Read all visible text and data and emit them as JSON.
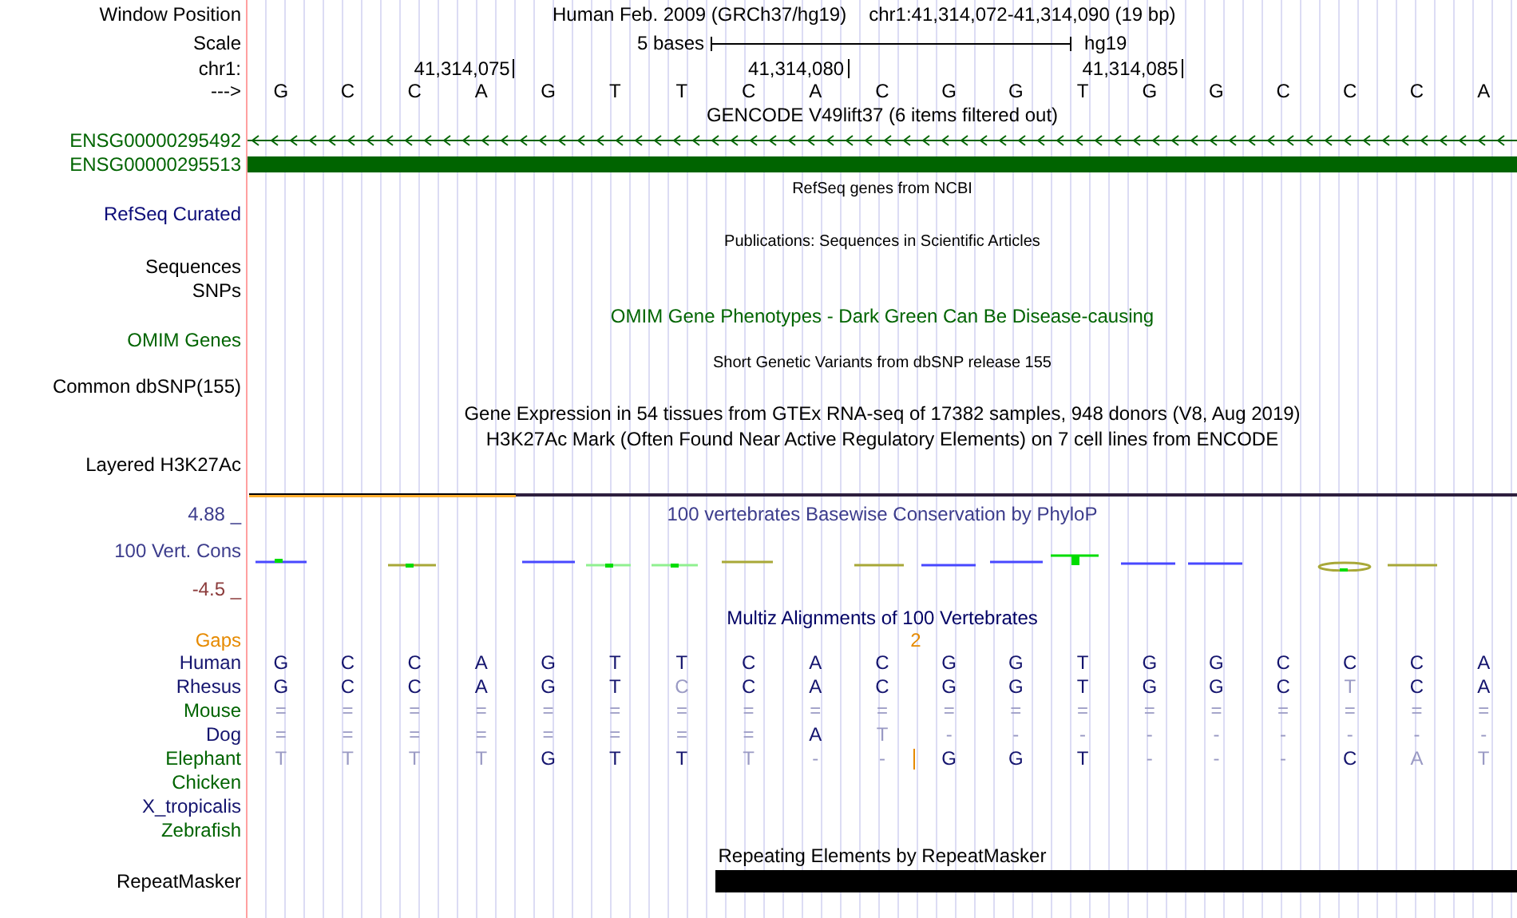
{
  "header": {
    "window_position": {
      "label": "Window Position",
      "assembly": "Human Feb. 2009 (GRCh37/hg19)",
      "position": "chr1:41,314,072-41,314,090 (19 bp)"
    },
    "scale": {
      "label": "Scale",
      "span": "5 bases",
      "assembly": "hg19"
    },
    "ruler": {
      "label": "chr1:"
    },
    "sequence": {
      "label": "--->",
      "bases": [
        {
          "base": "G"
        },
        {
          "base": "C"
        },
        {
          "base": "C"
        },
        {
          "base": "A",
          "tick": "41,314,075"
        },
        {
          "base": "G"
        },
        {
          "base": "T"
        },
        {
          "base": "T"
        },
        {
          "base": "C"
        },
        {
          "base": "A",
          "tick": "41,314,080"
        },
        {
          "base": "C"
        },
        {
          "base": "G"
        },
        {
          "base": "G"
        },
        {
          "base": "T"
        },
        {
          "base": "G",
          "tick": "41,314,085"
        },
        {
          "base": "G"
        },
        {
          "base": "C"
        },
        {
          "base": "C"
        },
        {
          "base": "C"
        },
        {
          "base": "A"
        }
      ]
    }
  },
  "tracks": [
    {
      "kind": "title",
      "title": {
        "text": "GENCODE V49lift37 (6 items filtered out)",
        "color": "#000000"
      }
    },
    {
      "kind": "gene-arrows",
      "label": {
        "text": "ENSG00000295492",
        "color": "#006400"
      }
    },
    {
      "kind": "gene-block",
      "label": {
        "text": "ENSG00000295513",
        "color": "#006400"
      }
    },
    {
      "kind": "small-title",
      "title": {
        "text": "RefSeq genes from NCBI",
        "color": "#000000"
      }
    },
    {
      "kind": "label",
      "label": {
        "text": "RefSeq Curated",
        "color": "#0c0c78"
      }
    },
    {
      "kind": "small-title",
      "title": {
        "text": "Publications: Sequences in Scientific Articles",
        "color": "#000000"
      }
    },
    {
      "kind": "label",
      "label": {
        "text": "Sequences",
        "color": "#000000"
      }
    },
    {
      "kind": "label",
      "label": {
        "text": "SNPs",
        "color": "#000000"
      }
    },
    {
      "kind": "title",
      "title": {
        "text": "OMIM Gene Phenotypes - Dark Green Can Be Disease-causing",
        "color": "#006400"
      }
    },
    {
      "kind": "label",
      "label": {
        "text": "OMIM Genes",
        "color": "#006400"
      }
    },
    {
      "kind": "small-title",
      "title": {
        "text": "Short Genetic Variants from dbSNP release 155",
        "color": "#000000"
      }
    },
    {
      "kind": "label",
      "label": {
        "text": "Common dbSNP(155)",
        "color": "#000000"
      }
    },
    {
      "kind": "title",
      "title": {
        "text": "Gene Expression in 54 tissues from GTEx RNA-seq of 17382 samples, 948 donors (V8, Aug 2019)",
        "color": "#000000"
      }
    },
    {
      "kind": "title",
      "title": {
        "text": "H3K27Ac Mark (Often Found Near Active Regulatory Elements) on 7 cell lines from ENCODE",
        "color": "#000000"
      }
    },
    {
      "kind": "label",
      "label": {
        "text": "Layered H3K27Ac",
        "color": "#000000"
      }
    },
    {
      "kind": "signal"
    },
    {
      "kind": "axis-title",
      "label": {
        "text": "4.88 _",
        "color": "#3c3c8c"
      },
      "title": {
        "text": "100 vertebrates Basewise Conservation by PhyloP",
        "color": "#3c3c8c"
      }
    },
    {
      "kind": "wiggle",
      "label": {
        "text": "100 Vert. Cons",
        "color": "#3c3c8c"
      }
    },
    {
      "kind": "label",
      "label": {
        "text": "-4.5 _",
        "color": "#8c3c3c"
      }
    },
    {
      "kind": "title",
      "title": {
        "text": "Multiz Alignments of 100 Vertebrates",
        "color": "#000064"
      }
    },
    {
      "kind": "gaps",
      "label": {
        "text": "Gaps",
        "color": "#e68a00"
      }
    },
    {
      "kind": "species",
      "label": {
        "text": "Human",
        "color": "#14146e"
      },
      "bases": [
        {
          "kind": "base",
          "base": "G",
          "dim": false
        },
        {
          "kind": "base",
          "base": "C",
          "dim": false
        },
        {
          "kind": "base",
          "base": "C",
          "dim": false
        },
        {
          "kind": "base",
          "base": "A",
          "dim": false
        },
        {
          "kind": "base",
          "base": "G",
          "dim": false
        },
        {
          "kind": "base",
          "base": "T",
          "dim": false
        },
        {
          "kind": "base",
          "base": "T",
          "dim": false
        },
        {
          "kind": "base",
          "base": "C",
          "dim": false
        },
        {
          "kind": "base",
          "base": "A",
          "dim": false
        },
        {
          "kind": "base",
          "base": "C",
          "dim": false
        },
        {
          "kind": "base",
          "base": "G",
          "dim": false
        },
        {
          "kind": "base",
          "base": "G",
          "dim": false
        },
        {
          "kind": "base",
          "base": "T",
          "dim": false
        },
        {
          "kind": "base",
          "base": "G",
          "dim": false
        },
        {
          "kind": "base",
          "base": "G",
          "dim": false
        },
        {
          "kind": "base",
          "base": "C",
          "dim": false
        },
        {
          "kind": "base",
          "base": "C",
          "dim": false
        },
        {
          "kind": "base",
          "base": "C",
          "dim": false
        },
        {
          "kind": "base",
          "base": "A",
          "dim": false
        }
      ]
    },
    {
      "kind": "species",
      "label": {
        "text": "Rhesus",
        "color": "#14146e"
      },
      "bases": [
        {
          "kind": "base",
          "base": "G",
          "dim": false
        },
        {
          "kind": "base",
          "base": "C",
          "dim": false
        },
        {
          "kind": "base",
          "base": "C",
          "dim": false
        },
        {
          "kind": "base",
          "base": "A",
          "dim": false
        },
        {
          "kind": "base",
          "base": "G",
          "dim": false
        },
        {
          "kind": "base",
          "base": "T",
          "dim": false
        },
        {
          "kind": "base",
          "base": "C",
          "dim": true
        },
        {
          "kind": "base",
          "base": "C",
          "dim": false
        },
        {
          "kind": "base",
          "base": "A",
          "dim": false
        },
        {
          "kind": "base",
          "base": "C",
          "dim": false
        },
        {
          "kind": "base",
          "base": "G",
          "dim": false
        },
        {
          "kind": "base",
          "base": "G",
          "dim": false
        },
        {
          "kind": "base",
          "base": "T",
          "dim": false
        },
        {
          "kind": "base",
          "base": "G",
          "dim": false
        },
        {
          "kind": "base",
          "base": "G",
          "dim": false
        },
        {
          "kind": "base",
          "base": "C",
          "dim": false
        },
        {
          "kind": "base",
          "base": "T",
          "dim": true
        },
        {
          "kind": "base",
          "base": "C",
          "dim": false
        },
        {
          "kind": "base",
          "base": "A",
          "dim": false
        }
      ]
    },
    {
      "kind": "species",
      "label": {
        "text": "Mouse",
        "color": "#006400"
      },
      "bases": [
        {
          "kind": "base",
          "base": "=",
          "dim": true
        },
        {
          "kind": "base",
          "base": "=",
          "dim": true
        },
        {
          "kind": "base",
          "base": "=",
          "dim": true
        },
        {
          "kind": "base",
          "base": "=",
          "dim": true
        },
        {
          "kind": "base",
          "base": "=",
          "dim": true
        },
        {
          "kind": "base",
          "base": "=",
          "dim": true
        },
        {
          "kind": "base",
          "base": "=",
          "dim": true
        },
        {
          "kind": "base",
          "base": "=",
          "dim": true
        },
        {
          "kind": "base",
          "base": "=",
          "dim": true
        },
        {
          "kind": "base",
          "base": "=",
          "dim": true
        },
        {
          "kind": "base",
          "base": "=",
          "dim": true
        },
        {
          "kind": "base",
          "base": "=",
          "dim": true
        },
        {
          "kind": "base",
          "base": "=",
          "dim": true
        },
        {
          "kind": "base",
          "base": "=",
          "dim": true
        },
        {
          "kind": "base",
          "base": "=",
          "dim": true
        },
        {
          "kind": "base",
          "base": "=",
          "dim": true
        },
        {
          "kind": "base",
          "base": "=",
          "dim": true
        },
        {
          "kind": "base",
          "base": "=",
          "dim": true
        },
        {
          "kind": "base",
          "base": "=",
          "dim": true
        }
      ]
    },
    {
      "kind": "species",
      "label": {
        "text": "Dog",
        "color": "#14146e"
      },
      "bases": [
        {
          "kind": "base",
          "base": "=",
          "dim": true
        },
        {
          "kind": "base",
          "base": "=",
          "dim": true
        },
        {
          "kind": "base",
          "base": "=",
          "dim": true
        },
        {
          "kind": "base",
          "base": "=",
          "dim": true
        },
        {
          "kind": "base",
          "base": "=",
          "dim": true
        },
        {
          "kind": "base",
          "base": "=",
          "dim": true
        },
        {
          "kind": "base",
          "base": "=",
          "dim": true
        },
        {
          "kind": "base",
          "base": "=",
          "dim": true
        },
        {
          "kind": "base",
          "base": "A",
          "dim": false
        },
        {
          "kind": "base",
          "base": "T",
          "dim": true
        },
        {
          "kind": "base",
          "base": "-",
          "dim": true
        },
        {
          "kind": "base",
          "base": "-",
          "dim": true
        },
        {
          "kind": "base",
          "base": "-",
          "dim": true
        },
        {
          "kind": "base",
          "base": "-",
          "dim": true
        },
        {
          "kind": "base",
          "base": "-",
          "dim": true
        },
        {
          "kind": "base",
          "base": "-",
          "dim": true
        },
        {
          "kind": "base",
          "base": "-",
          "dim": true
        },
        {
          "kind": "base",
          "base": "-",
          "dim": true
        },
        {
          "kind": "base",
          "base": "-",
          "dim": true
        }
      ]
    },
    {
      "kind": "species",
      "label": {
        "text": "Elephant",
        "color": "#006400"
      },
      "bases": [
        {
          "kind": "base",
          "base": "T",
          "dim": true
        },
        {
          "kind": "base",
          "base": "T",
          "dim": true
        },
        {
          "kind": "base",
          "base": "T",
          "dim": true
        },
        {
          "kind": "base",
          "base": "T",
          "dim": true
        },
        {
          "kind": "base",
          "base": "G",
          "dim": false
        },
        {
          "kind": "base",
          "base": "T",
          "dim": false
        },
        {
          "kind": "base",
          "base": "T",
          "dim": false
        },
        {
          "kind": "base",
          "base": "T",
          "dim": true
        },
        {
          "kind": "base",
          "base": "-",
          "dim": true
        },
        {
          "kind": "base",
          "base": "-",
          "dim": true
        },
        {
          "kind": "insertion",
          "count": "2"
        },
        {
          "kind": "base",
          "base": "G",
          "dim": false
        },
        {
          "kind": "base",
          "base": "G",
          "dim": false
        },
        {
          "kind": "base",
          "base": "T",
          "dim": false
        },
        {
          "kind": "base",
          "base": "-",
          "dim": true
        },
        {
          "kind": "base",
          "base": "-",
          "dim": true
        },
        {
          "kind": "base",
          "base": "-",
          "dim": true
        },
        {
          "kind": "base",
          "base": "C",
          "dim": false
        },
        {
          "kind": "base",
          "base": "A",
          "dim": true
        },
        {
          "kind": "base",
          "base": "T",
          "dim": true
        }
      ]
    },
    {
      "kind": "species",
      "label": {
        "text": "Chicken",
        "color": "#006400"
      }
    },
    {
      "kind": "species",
      "label": {
        "text": "X_tropicalis",
        "color": "#14146e"
      }
    },
    {
      "kind": "species",
      "label": {
        "text": "Zebrafish",
        "color": "#006400"
      }
    },
    {
      "kind": "title",
      "title": {
        "text": "Repeating Elements by RepeatMasker",
        "color": "#000000"
      }
    },
    {
      "kind": "repeat",
      "label": {
        "text": "RepeatMasker",
        "color": "#000000"
      }
    }
  ]
}
